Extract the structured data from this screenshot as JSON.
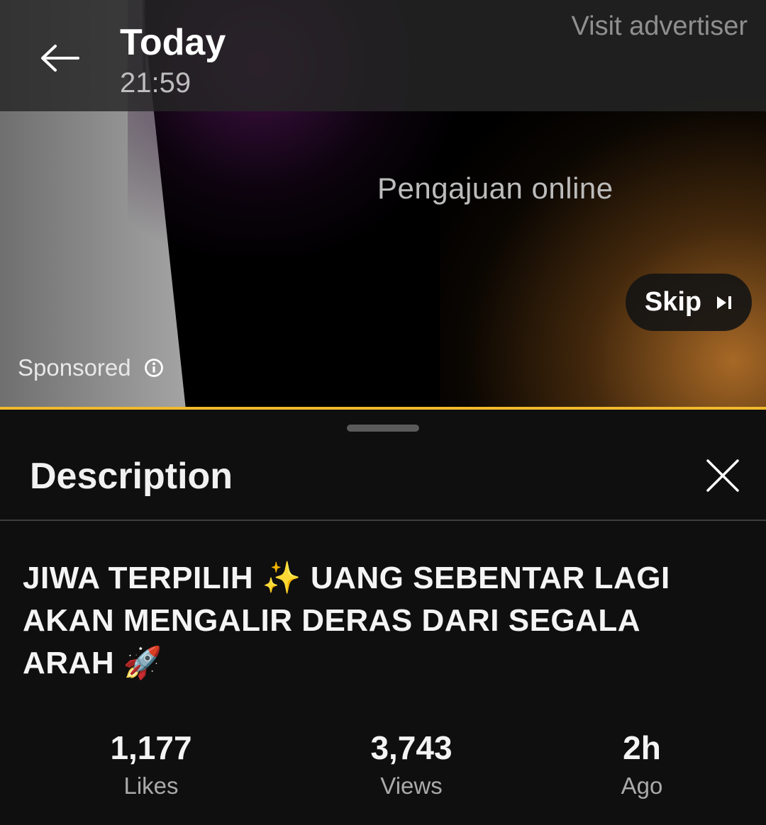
{
  "header": {
    "title": "Today",
    "subtitle": "21:59",
    "visit_advertiser": "Visit advertiser",
    "back_icon": "arrow-left-icon"
  },
  "ad": {
    "overlay_text": "Pengajuan online",
    "skip_label": "Skip",
    "skip_icon": "skip-next-icon",
    "sponsored_label": "Sponsored",
    "info_icon": "info-icon",
    "progress_color": "#f0b92c"
  },
  "description": {
    "title": "Description",
    "close_icon": "close-icon",
    "video_title": "JIWA TERPILIH ✨ UANG SEBENTAR LAGI AKAN MENGALIR DERAS DARI SEGALA ARAH 🚀",
    "stats": [
      {
        "value": "1,177",
        "label": "Likes"
      },
      {
        "value": "3,743",
        "label": "Views"
      },
      {
        "value": "2h",
        "label": "Ago"
      }
    ]
  }
}
